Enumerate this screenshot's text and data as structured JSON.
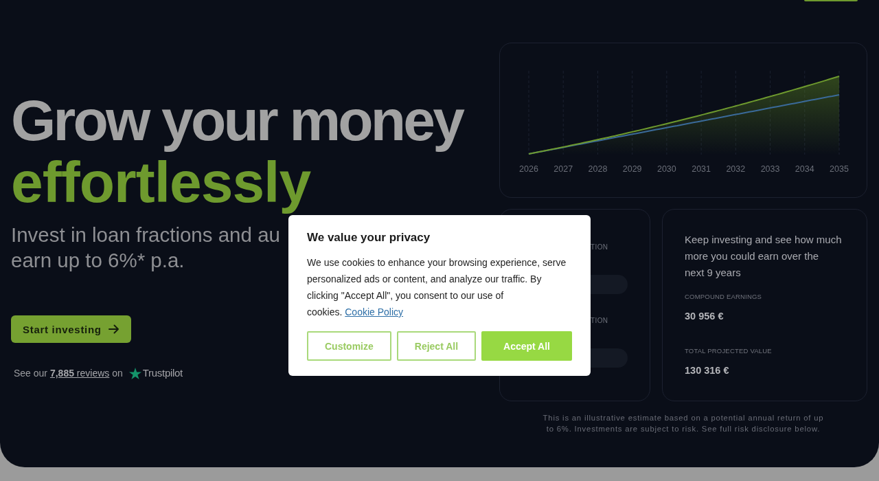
{
  "hero": {
    "headline": "Grow your money",
    "headline_accent": "effortlessly",
    "subtitle_lines": [
      "Invest in loan fractions and au",
      "earn up to 6%* p.a."
    ],
    "cta": {
      "label": "Start investing"
    },
    "reviews": {
      "prefix": "See our",
      "link": "**7,885** reviews",
      "suffix": "on",
      "brand": "Trustpilot"
    }
  },
  "growth_chart": {
    "year_labels": [
      "2026",
      "2027",
      "2028",
      "2029",
      "2030",
      "2031",
      "2032",
      "2033",
      "2034",
      "2035"
    ]
  },
  "calculator": {
    "fields": [
      {
        "label": "TION"
      },
      {
        "label": "TION"
      }
    ]
  },
  "projection": {
    "intro": "Keep investing and see how much more you could earn over the next 9 years",
    "stats": [
      {
        "label": "COMPOUND EARNINGS",
        "value": "30 956 €"
      },
      {
        "label": "TOTAL PROJECTED VALUE",
        "value": "130 316 €"
      }
    ]
  },
  "disclaimer": "This is an illustrative estimate based on a potential annual return of up to 6%. Investments are subject to risk. See full risk disclosure below.",
  "cookie_dialog": {
    "title": "We value your privacy",
    "body": "We use cookies to enhance your browsing experience, serve personalized ads or content, and analyze our traffic. By clicking \"Accept All\", you consent to our use of cookies.",
    "link": "Cookie Policy",
    "buttons": [
      {
        "label": "Customize",
        "kind": "outline"
      },
      {
        "label": "Reject All",
        "kind": "outline"
      },
      {
        "label": "Accept All",
        "kind": "filled"
      }
    ]
  }
}
